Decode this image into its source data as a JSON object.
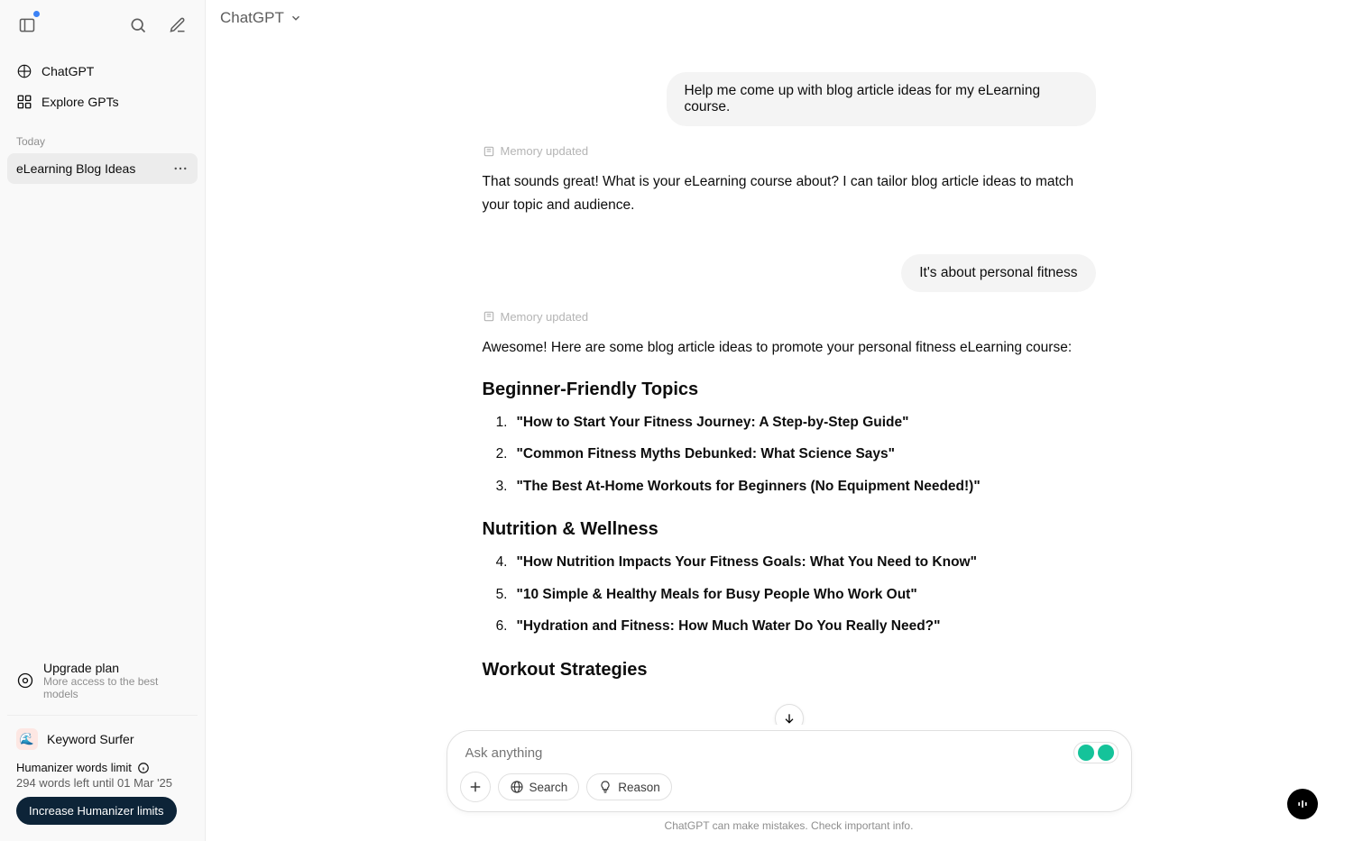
{
  "sidebar": {
    "nav": {
      "chatgpt": "ChatGPT",
      "explore": "Explore GPTs"
    },
    "section_today": "Today",
    "conversation": "eLearning Blog Ideas",
    "upgrade": {
      "title": "Upgrade plan",
      "subtitle": "More access to the best models"
    },
    "keyword_surfer": "Keyword Surfer",
    "humanizer": {
      "title": "Humanizer words limit",
      "subtitle": "294 words left until 01 Mar '25",
      "button": "Increase Humanizer limits"
    }
  },
  "header": {
    "model": "ChatGPT"
  },
  "chat": {
    "user1": "Help me come up with blog article ideas for my eLearning course.",
    "memory_updated": "Memory updated",
    "assistant1": "That sounds great! What is your eLearning course about? I can tailor blog article ideas to match your topic and audience.",
    "user2": "It's about personal fitness",
    "assistant2_intro": "Awesome! Here are some blog article ideas to promote your personal fitness eLearning course:",
    "section1_title": "Beginner-Friendly Topics",
    "section1_items": [
      "\"How to Start Your Fitness Journey: A Step-by-Step Guide\"",
      "\"Common Fitness Myths Debunked: What Science Says\"",
      "\"The Best At-Home Workouts for Beginners (No Equipment Needed!)\""
    ],
    "section2_title": "Nutrition & Wellness",
    "section2_items": [
      "\"How Nutrition Impacts Your Fitness Goals: What You Need to Know\"",
      "\"10 Simple & Healthy Meals for Busy People Who Work Out\"",
      "\"Hydration and Fitness: How Much Water Do You Really Need?\""
    ],
    "section3_title": "Workout Strategies"
  },
  "composer": {
    "placeholder": "Ask anything",
    "search": "Search",
    "reason": "Reason"
  },
  "footer": {
    "disclaimer": "ChatGPT can make mistakes. Check important info."
  }
}
